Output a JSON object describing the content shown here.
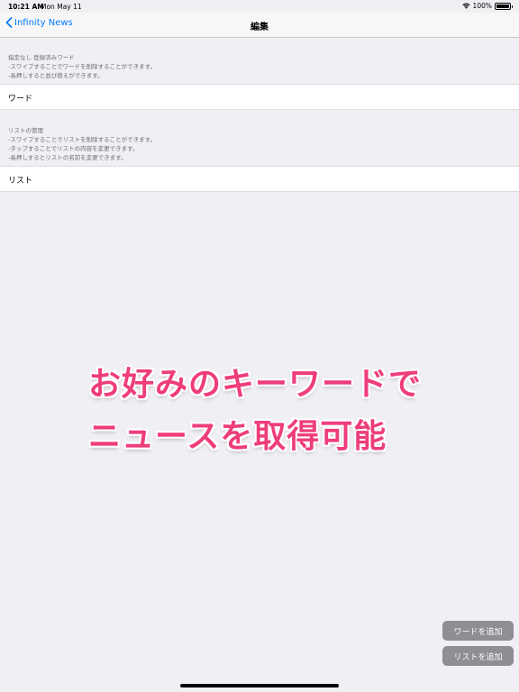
{
  "status_bar": {
    "time": "10:21 AM",
    "date": "Mon May 11",
    "battery": "100%",
    "battery_level": 1.0
  },
  "nav": {
    "back_label": "Infinity News",
    "title": "編集"
  },
  "words_section": {
    "header_lines": [
      "指定なし 登録済みワード",
      "-スワイプすることでワードを削除することができます。",
      "-長押しすると並び替えができます。"
    ],
    "cell_label": "ワード"
  },
  "lists_section": {
    "header_lines": [
      "リストの管理",
      "-スワイプすることでリストを削除することができます。",
      "-タップすることでリストの内容を変更できます。",
      "-長押しするとリストの名前を変更できます。"
    ],
    "cell_label": "リスト"
  },
  "promo": {
    "line1": "お好みのキーワードで",
    "line2": "ニュースを取得可能",
    "color": "#ee3d7b"
  },
  "actions": {
    "add_word": "ワードを追加",
    "add_list": "リストを追加"
  },
  "colors": {
    "accent": "#007aff",
    "background": "#efeff4",
    "button_gray": "#8e8e93"
  }
}
